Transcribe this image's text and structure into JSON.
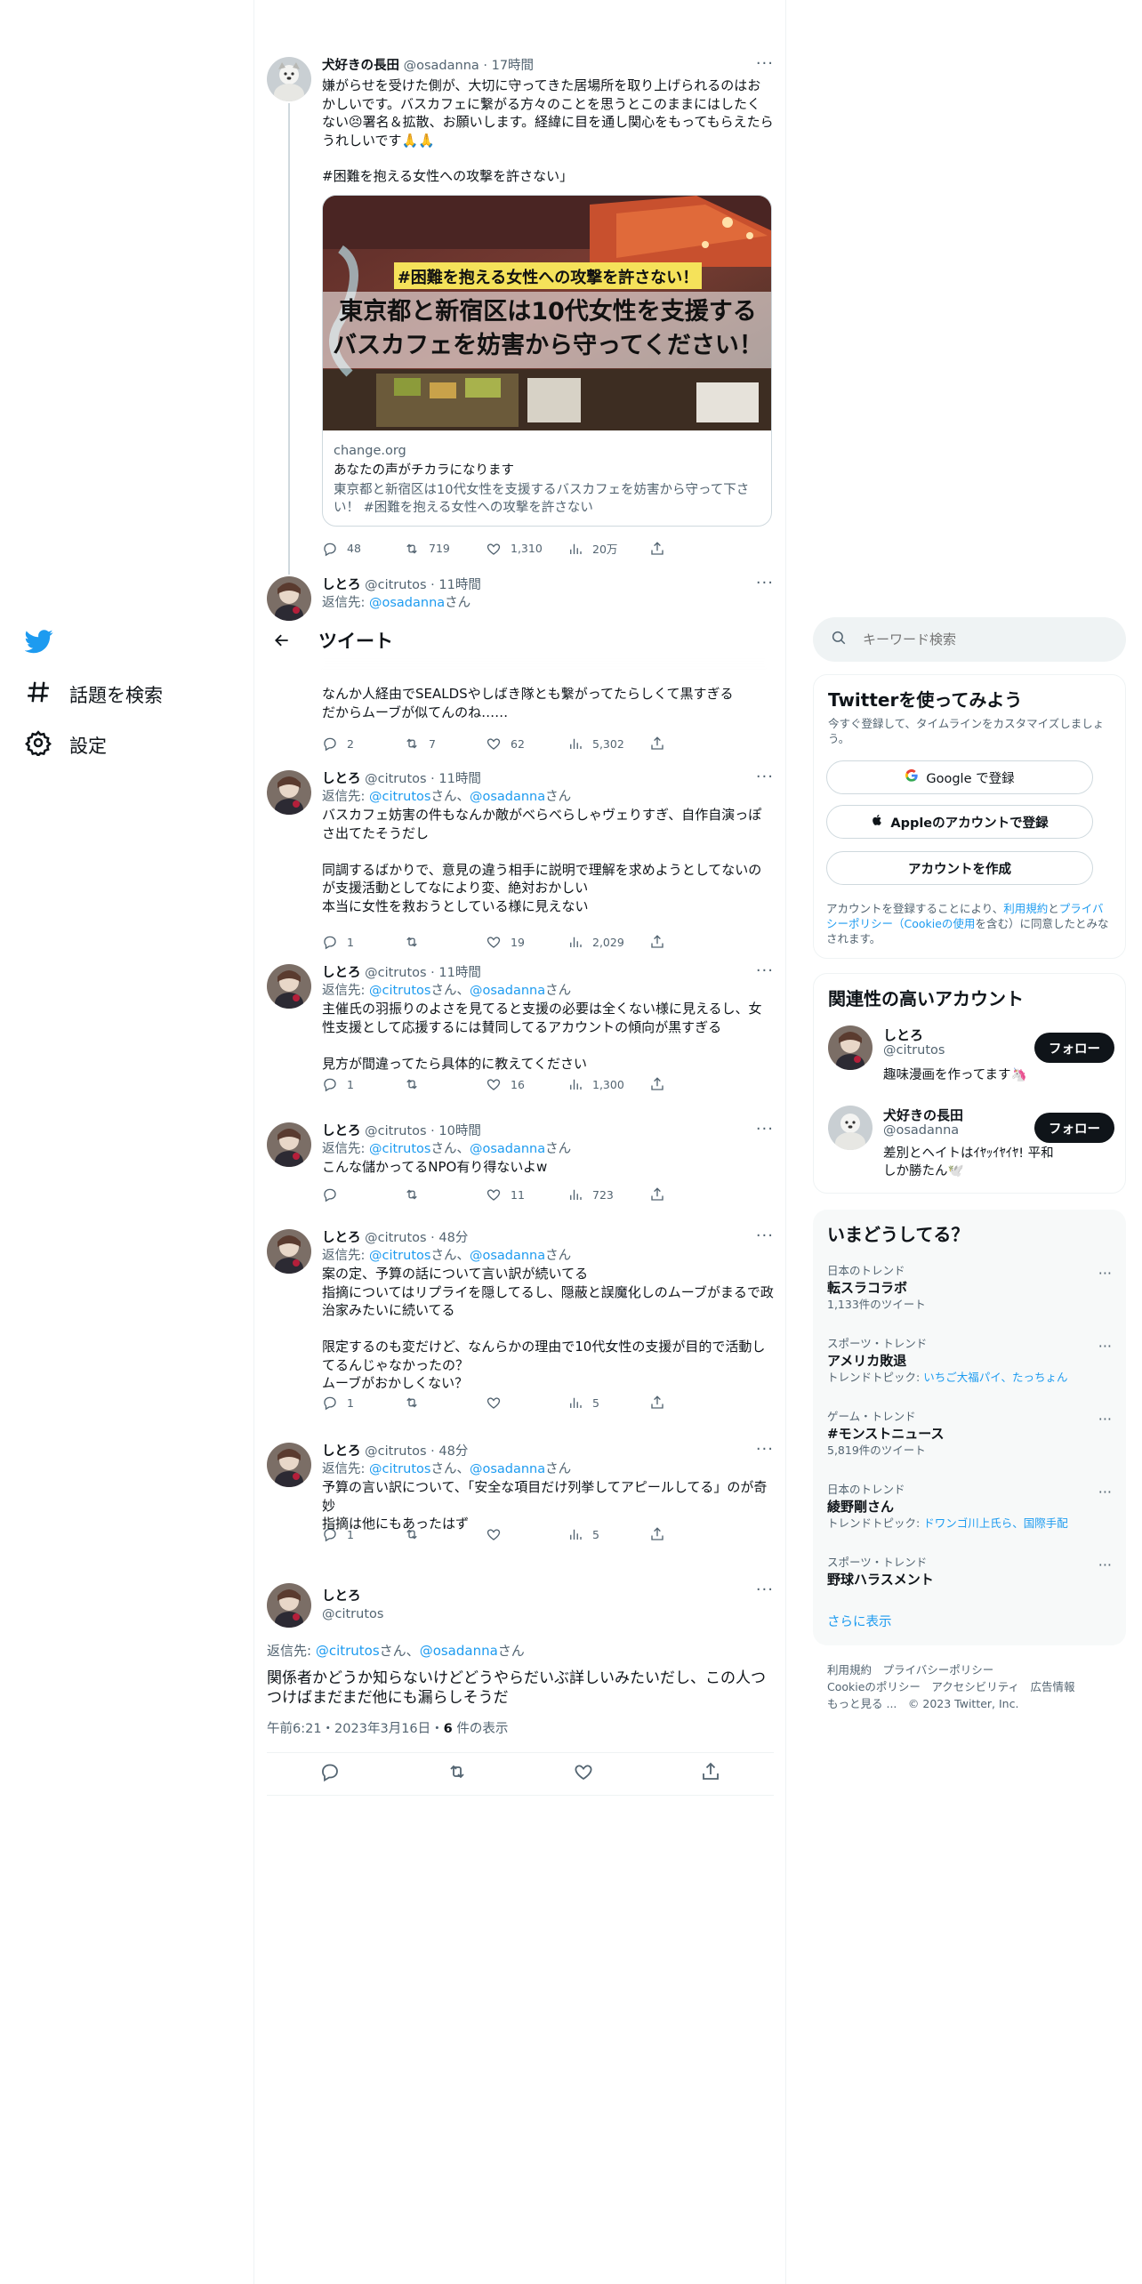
{
  "nav": {
    "explore_label": "話題を検索",
    "settings_label": "設定"
  },
  "header": {
    "title": "ツイート"
  },
  "tweets": [
    {
      "name": "犬好きの長田",
      "handle": "@osadanna",
      "time": "17時間",
      "text": "嫌がらせを受けた側が、大切に守ってきた居場所を取り上げられるのはおかしいです。バスカフェに繋がる方々のことを思うとこのままにはしたくない😣署名＆拡散、お願いします。経緯に目を通し関心をもってもらえたらうれしいです🙏🙏",
      "hashtag": "#困難を抱える女性への攻撃を許さない」",
      "card": {
        "banner_tag": "#困難を抱える女性への攻撃を許さない！",
        "headline_1": "東京都と新宿区は10代女性を支援する",
        "headline_2": "バスカフェを妨害から守ってください！",
        "domain": "change.org",
        "title": "あなたの声がチカラになります",
        "desc": "東京都と新宿区は10代女性を支援するバスカフェを妨害から守って下さい！ #困難を抱える女性への攻撃を許さない"
      },
      "replies": "48",
      "retweets": "719",
      "likes": "1,310",
      "views": "20万"
    },
    {
      "name": "しとろ",
      "handle": "@citrutos",
      "time": "11時間",
      "reply_prefix": "返信先: ",
      "reply_to_1": "@osadanna",
      "reply_suffix": "さん",
      "text": "なんか人経由でSEALDSやしばき隊とも繋がってたらしくて黒すぎる\nだからムーブが似てんのね……",
      "replies": "2",
      "retweets": "7",
      "likes": "62",
      "views": "5,302"
    },
    {
      "name": "しとろ",
      "handle": "@citrutos",
      "time": "11時間",
      "reply_prefix": "返信先: ",
      "reply_to_1": "@citrutos",
      "reply_mid": "さん、",
      "reply_to_2": "@osadanna",
      "reply_suffix": "さん",
      "text": "バスカフェ妨害の件もなんか敵がべらべらしゃヴェりすぎ、自作自演っぽさ出てたそうだし\n\n同調するばかりで、意見の違う相手に説明で理解を求めようとしてないのが支援活動としてなにより変、絶対おかしい\n本当に女性を救おうとしている様に見えない",
      "replies": "1",
      "retweets": "",
      "likes": "19",
      "views": "2,029"
    },
    {
      "name": "しとろ",
      "handle": "@citrutos",
      "time": "11時間",
      "reply_prefix": "返信先: ",
      "reply_to_1": "@citrutos",
      "reply_mid": "さん、",
      "reply_to_2": "@osadanna",
      "reply_suffix": "さん",
      "text": "主催氏の羽振りのよさを見てると支援の必要は全くない様に見えるし、女性支援として応援するには賛同してるアカウントの傾向が黒すぎる\n\n見方が間違ってたら具体的に教えてください",
      "replies": "1",
      "retweets": "",
      "likes": "16",
      "views": "1,300"
    },
    {
      "name": "しとろ",
      "handle": "@citrutos",
      "time": "10時間",
      "reply_prefix": "返信先: ",
      "reply_to_1": "@citrutos",
      "reply_mid": "さん、",
      "reply_to_2": "@osadanna",
      "reply_suffix": "さん",
      "text": "こんな儲かってるNPO有り得ないよw",
      "replies": "",
      "retweets": "",
      "likes": "11",
      "views": "723"
    },
    {
      "name": "しとろ",
      "handle": "@citrutos",
      "time": "48分",
      "reply_prefix": "返信先: ",
      "reply_to_1": "@citrutos",
      "reply_mid": "さん、",
      "reply_to_2": "@osadanna",
      "reply_suffix": "さん",
      "text": "案の定、予算の話について言い訳が続いてる\n指摘についてはリプライを隠してるし、隠蔽と誤魔化しのムーブがまるで政治家みたいに続いてる\n\n限定するのも変だけど、なんらかの理由で10代女性の支援が目的で活動してるんじゃなかったの？\nムーブがおかしくない？",
      "replies": "1",
      "retweets": "",
      "likes": "",
      "views": "5"
    },
    {
      "name": "しとろ",
      "handle": "@citrutos",
      "time": "48分",
      "reply_prefix": "返信先: ",
      "reply_to_1": "@citrutos",
      "reply_mid": "さん、",
      "reply_to_2": "@osadanna",
      "reply_suffix": "さん",
      "text": "予算の言い訳について、「安全な項目だけ列挙してアピールしてる」のが奇妙\n指摘は他にもあったはず",
      "replies": "1",
      "retweets": "",
      "likes": "",
      "views": "5"
    }
  ],
  "main_tweet": {
    "name": "しとろ",
    "handle": "@citrutos",
    "reply_prefix": "返信先: ",
    "reply_to_1": "@citrutos",
    "reply_mid": "さん、",
    "reply_to_2": "@osadanna",
    "reply_suffix": "さん",
    "text": "関係者かどうか知らないけどどうやらだいぶ詳しいみたいだし、この人つつけばまだまだ他にも漏らしそうだ",
    "timestamp": "午前6:21・2023年3月16日・",
    "view_count": "6",
    "view_label": " 件の表示"
  },
  "search": {
    "placeholder": "キーワード検索"
  },
  "signup": {
    "title": "Twitterを使ってみよう",
    "subtitle": "今すぐ登録して、タイムラインをカスタマイズしましょう。",
    "google_label": "Google で登録",
    "apple_label": "Appleのアカウントで登録",
    "create_label": "アカウントを作成",
    "legal_1": "アカウントを登録することにより、",
    "legal_link_1": "利用規約",
    "legal_2": "と",
    "legal_link_2": "プライバシーポリシー（Cookieの使用",
    "legal_3": "を含む）に同意したとみなされます。"
  },
  "related": {
    "title": "関連性の高いアカウント",
    "accounts": [
      {
        "name": "しとろ",
        "handle": "@citrutos",
        "bio": "趣味漫画を作ってます🦄",
        "follow_label": "フォロー"
      },
      {
        "name": "犬好きの長田",
        "handle": "@osadanna",
        "bio": "差別とヘイトはｲﾔｯｲﾔｲﾔ! 平和しか勝たん🕊️",
        "follow_label": "フォロー"
      }
    ]
  },
  "trends": {
    "title": "いまどうしてる？",
    "items": [
      {
        "category": "日本のトレンド",
        "name": "転スラコラボ",
        "sub": "1,133件のツイート"
      },
      {
        "category": "スポーツ・トレンド",
        "name": "アメリカ敗退",
        "sub_prefix": "トレンドトピック: ",
        "sub_link": "いちご大福パイ、たっちょん"
      },
      {
        "category": "ゲーム・トレンド",
        "name": "#モンストニュース",
        "sub": "5,819件のツイート"
      },
      {
        "category": "日本のトレンド",
        "name": "綾野剛さん",
        "sub_prefix": "トレンドトピック: ",
        "sub_link": "ドワンゴ川上氏ら、国際手配"
      },
      {
        "category": "スポーツ・トレンド",
        "name": "野球ハラスメント"
      }
    ],
    "show_more": "さらに表示"
  },
  "footer": {
    "line1": "利用規約　プライバシーポリシー",
    "line2": "Cookieのポリシー　アクセシビリティ　広告情報",
    "line3": "もっと見る ...　© 2023 Twitter, Inc."
  },
  "colors": {
    "accent": "#1d9bf0",
    "text": "#0f1419",
    "secondary": "#536471"
  }
}
